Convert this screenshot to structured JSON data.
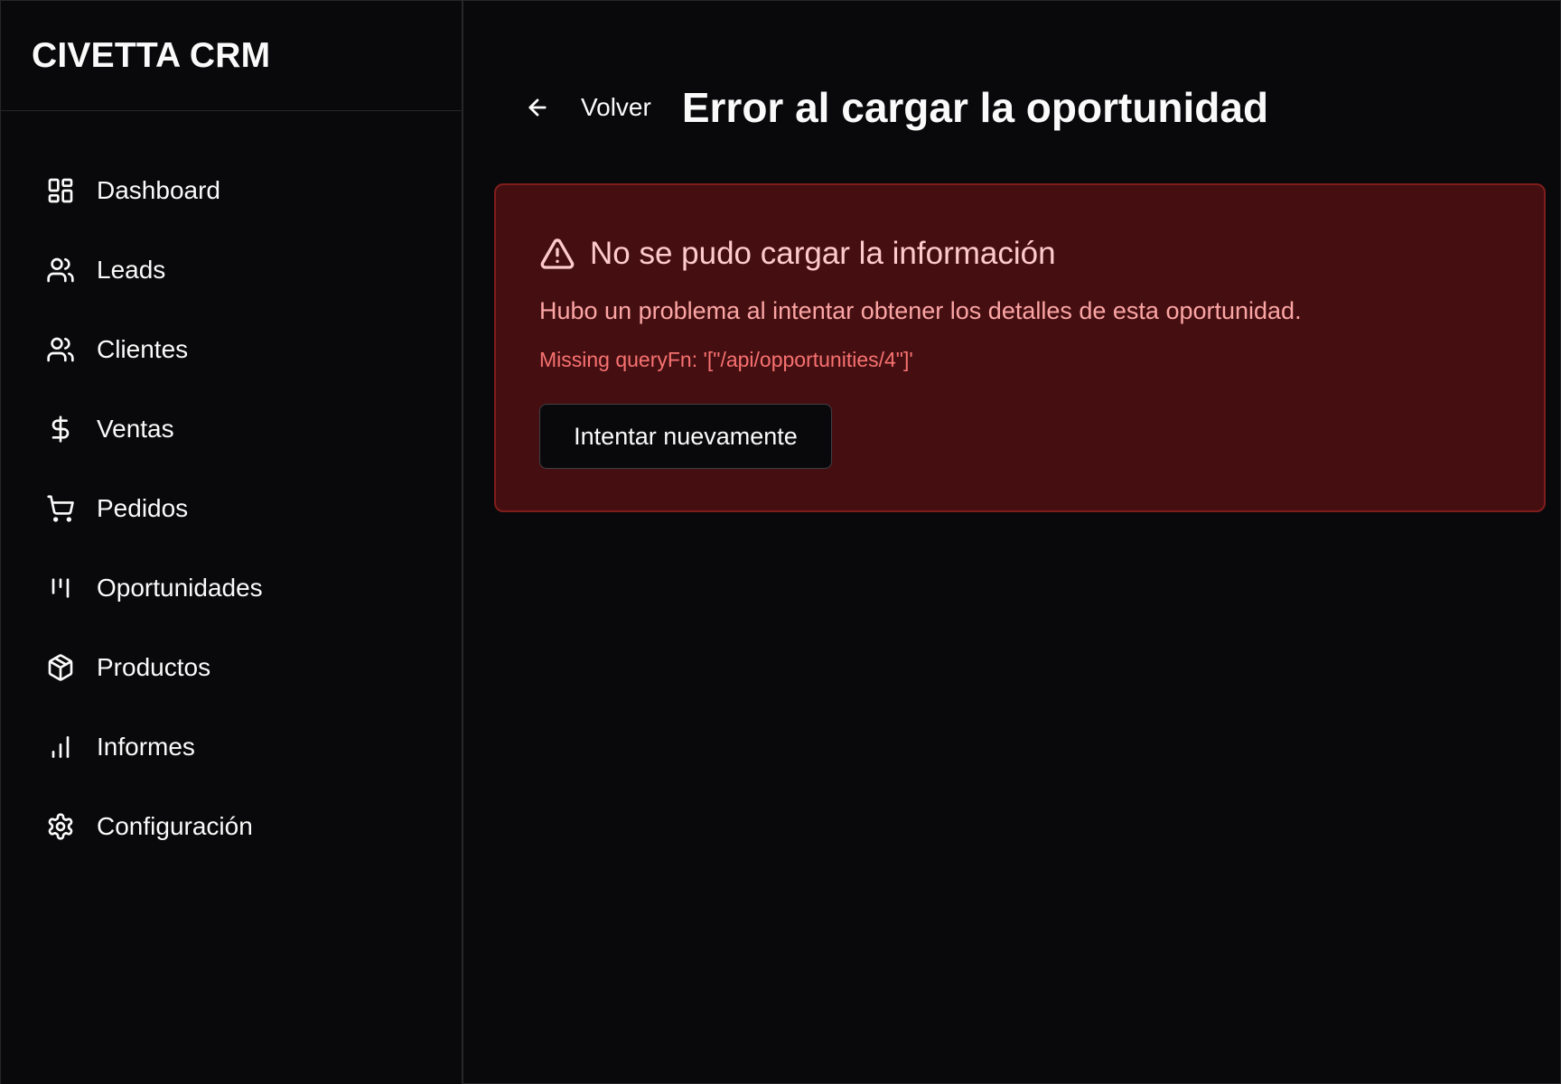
{
  "brand": {
    "name": "CIVETTA CRM"
  },
  "sidebar": {
    "items": [
      {
        "label": "Dashboard",
        "icon": "dashboard-icon"
      },
      {
        "label": "Leads",
        "icon": "users-icon"
      },
      {
        "label": "Clientes",
        "icon": "users-icon"
      },
      {
        "label": "Ventas",
        "icon": "dollar-icon"
      },
      {
        "label": "Pedidos",
        "icon": "cart-icon"
      },
      {
        "label": "Oportunidades",
        "icon": "kanban-icon"
      },
      {
        "label": "Productos",
        "icon": "package-icon"
      },
      {
        "label": "Informes",
        "icon": "bar-chart-icon"
      },
      {
        "label": "Configuración",
        "icon": "settings-icon"
      }
    ]
  },
  "header": {
    "back_label": "Volver",
    "title": "Error al cargar la oportunidad"
  },
  "error": {
    "title": "No se pudo cargar la información",
    "description": "Hubo un problema al intentar obtener los detalles de esta oportunidad.",
    "detail": "Missing queryFn: '[\"/api/opportunities/4\"]'",
    "retry_label": "Intentar nuevamente"
  },
  "colors": {
    "background": "#09090b",
    "error_bg": "#450f11",
    "error_border": "#7f1d1d",
    "error_title": "#fecaca",
    "error_text": "#fca5a5",
    "error_detail": "#f87171"
  }
}
